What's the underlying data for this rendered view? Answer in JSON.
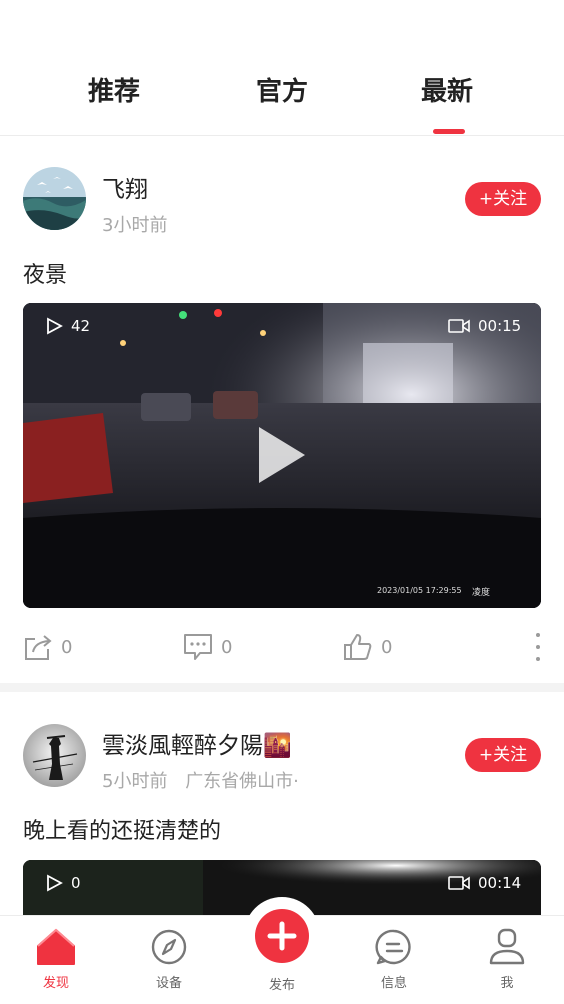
{
  "tabs": [
    "推荐",
    "官方",
    "最新"
  ],
  "active_tab": "最新",
  "posts": [
    {
      "username": "飞翔",
      "time": "3小时前",
      "location": "",
      "follow_label": "+关注",
      "caption": "夜景",
      "play_count": "42",
      "duration": "00:15",
      "video_timestamp": "2023/01/05 17:29:55",
      "video_watermark": "凌度",
      "share_count": "0",
      "comment_count": "0",
      "like_count": "0"
    },
    {
      "username": "雲淡風輕醉夕陽",
      "username_emoji": "🌇",
      "time": "5小时前",
      "location": "广东省佛山市·",
      "follow_label": "+关注",
      "caption": "晚上看的还挺清楚的",
      "play_count": "0",
      "duration": "00:14"
    }
  ],
  "bottom_nav": [
    {
      "label": "发现",
      "icon": "home-icon",
      "active": true
    },
    {
      "label": "设备",
      "icon": "compass-icon",
      "active": false
    },
    {
      "label": "发布",
      "icon": "plus-icon",
      "active": false
    },
    {
      "label": "信息",
      "icon": "message-icon",
      "active": false
    },
    {
      "label": "我",
      "icon": "user-icon",
      "active": false
    }
  ],
  "colors": {
    "accent": "#ef3340",
    "muted": "#a8a8a8",
    "text": "#222222"
  }
}
